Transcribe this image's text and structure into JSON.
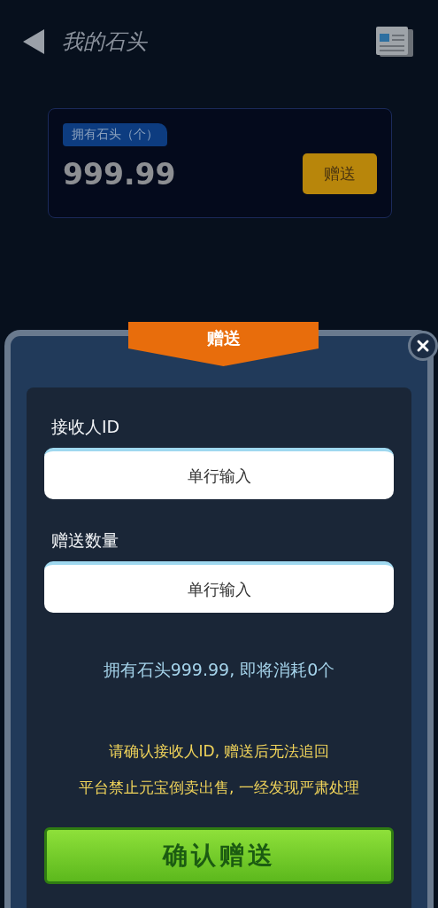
{
  "header": {
    "title": "我的石头"
  },
  "balance_card": {
    "label": "拥有石头（个）",
    "amount": "999.99",
    "button": "赠送"
  },
  "dialog": {
    "title": "赠送",
    "fields": [
      {
        "label": "接收人ID",
        "placeholder": "单行输入"
      },
      {
        "label": "赠送数量",
        "placeholder": "单行输入"
      }
    ],
    "summary": "拥有石头999.99, 即将消耗0个",
    "warnings": [
      "请确认接收人ID, 赠送后无法追回",
      "平台禁止元宝倒卖出售, 一经发现严肃处理"
    ],
    "confirm_button": "确认赠送"
  }
}
